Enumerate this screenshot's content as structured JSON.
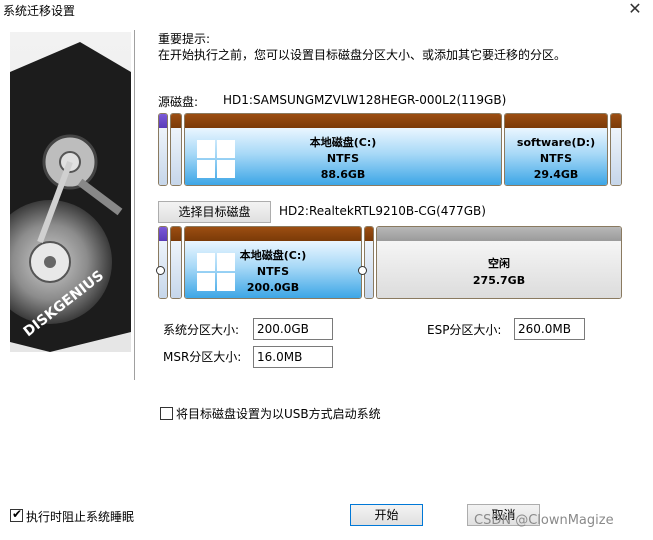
{
  "window": {
    "title": "系统迁移设置",
    "close_glyph": "✕"
  },
  "hint": {
    "title": "重要提示:",
    "body": "在开始执行之前，您可以设置目标磁盘分区大小、或添加其它要迁移的分区。"
  },
  "source": {
    "label": "源磁盘:",
    "disk": "HD1:SAMSUNGMZVLW128HEGR-000L2(119GB)",
    "partitions": [
      {
        "name": "本地磁盘(C:)",
        "fs": "NTFS",
        "size": "88.6GB"
      },
      {
        "name": "software(D:)",
        "fs": "NTFS",
        "size": "29.4GB"
      }
    ]
  },
  "target": {
    "select_button": "选择目标磁盘",
    "disk": "HD2:RealtekRTL9210B-CG(477GB)",
    "partitions": [
      {
        "name": "本地磁盘(C:)",
        "fs": "NTFS",
        "size": "200.0GB"
      },
      {
        "name": "空闲",
        "size": "275.7GB"
      }
    ]
  },
  "fields": {
    "system_label": "系统分区大小:",
    "system_value": "200.0GB",
    "esp_label": "ESP分区大小:",
    "esp_value": "260.0MB",
    "msr_label": "MSR分区大小:",
    "msr_value": "16.0MB"
  },
  "usb_option": {
    "label": "将目标磁盘设置为以USB方式启动系统",
    "checked": false
  },
  "prevent_sleep": {
    "label": "执行时阻止系统睡眠",
    "checked": true
  },
  "buttons": {
    "start": "开始",
    "cancel": "取消"
  },
  "brand": "DISKGENIUS",
  "watermark": "CSDN @ClownMagize",
  "colors": {
    "partition_header": "#8b4513",
    "ntfs_fill": "#3da6e6",
    "accent": "#0078d7"
  }
}
